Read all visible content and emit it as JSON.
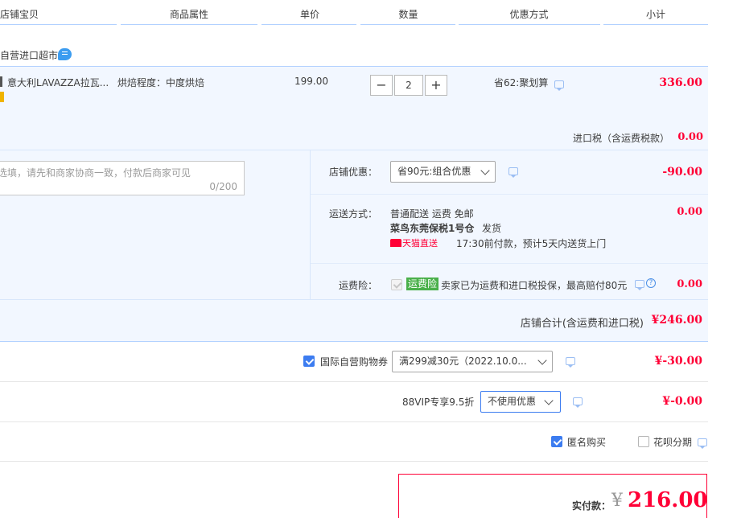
{
  "header": {
    "col_item": "店铺宝贝",
    "col_attr": "商品属性",
    "col_price": "单价",
    "col_qty": "数量",
    "col_discount": "优惠方式",
    "col_subtotal": "小计"
  },
  "shop": {
    "name": "自营进口超市"
  },
  "item": {
    "title": "意大利LAVAZZA拉瓦...",
    "attr": "烘焙程度：中度烘焙",
    "price": "199.00",
    "qty": "2",
    "qty_minus": "−",
    "qty_plus": "+",
    "discount": "省62:聚划算",
    "subtotal": "336.00"
  },
  "import_tax": {
    "label": "进口税（含运费税款）",
    "value": "0.00"
  },
  "message": {
    "placeholder": "选填，请先和商家协商一致，付款后商家可见",
    "counter": "0/200"
  },
  "shop_discount": {
    "label": "店铺优惠：",
    "selected": "省90元:组合优惠",
    "value": "-90.00"
  },
  "shipping": {
    "label": "运送方式：",
    "method": "普通配送 运费 免邮",
    "warehouse": "菜鸟东莞保税1号仓",
    "warehouse_suffix": "发货",
    "badge": "天猫直送",
    "eta": "17:30前付款，预计5天内送货上门",
    "value": "0.00"
  },
  "insurance": {
    "label": "运费险：",
    "tag": "运费险",
    "desc": "卖家已为运费和进口税投保，最高赔付80元",
    "value": "0.00"
  },
  "shop_total": {
    "label": "店铺合计(含运费和进口税)",
    "value": "¥246.00"
  },
  "coupon": {
    "label": "国际自营购物券",
    "selected": "满299减30元（2022.10.0...",
    "value": "¥-30.00"
  },
  "vip": {
    "label": "88VIP专享9.5折",
    "selected": "不使用优惠",
    "value": "¥-0.00"
  },
  "options": {
    "anonymous": "匿名购买",
    "huabei": "花呗分期"
  },
  "payment": {
    "label": "实付款：",
    "currency": "¥",
    "amount": "216.00"
  },
  "colors": {
    "accent_red": "#ff0036",
    "accent_blue": "#3c7cf0",
    "row_bg": "#f2f7ff",
    "tmall_red": "#ff0036",
    "insurance_green": "#4ab04a"
  }
}
